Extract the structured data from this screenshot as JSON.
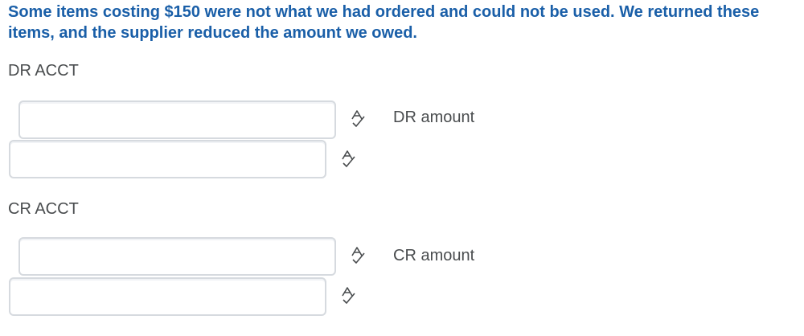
{
  "question": {
    "text": "Some items costing $150 were not what we had ordered and could not be used. We returned these items, and the supplier reduced the amount we owed."
  },
  "debit": {
    "label": "DR ACCT",
    "account_input": {
      "value": "",
      "placeholder": ""
    },
    "amount_label": "DR amount",
    "amount_input": {
      "value": "",
      "placeholder": ""
    }
  },
  "credit": {
    "label": "CR ACCT",
    "account_input": {
      "value": "",
      "placeholder": ""
    },
    "amount_label": "CR amount",
    "amount_input": {
      "value": "",
      "placeholder": ""
    }
  },
  "icons": {
    "spellcheck": "spellcheck-icon"
  },
  "colors": {
    "question_text": "#1a5fa8",
    "body_text": "#494c4e",
    "field_border": "#d6dadf"
  }
}
